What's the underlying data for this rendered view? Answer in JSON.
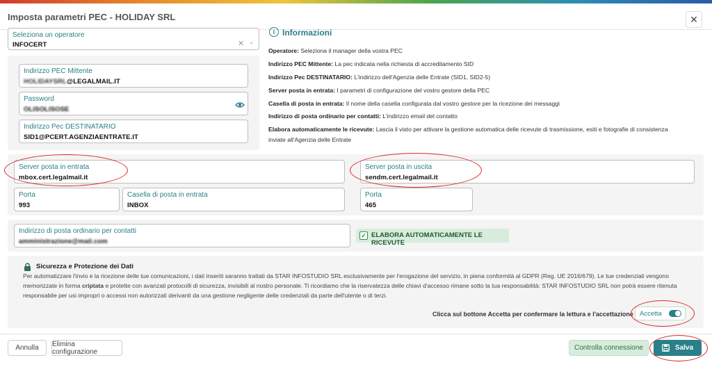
{
  "window": {
    "title": "Imposta parametri PEC - HOLIDAY SRL",
    "close_label": "✕"
  },
  "operatore": {
    "label": "Seleziona un operatore",
    "value": "INFOCERT"
  },
  "pec": {
    "mittente": {
      "label": "Indirizzo PEC Mittente",
      "value_blurred": "HOLIDAYSRL",
      "value_suffix": "@LEGALMAIL.IT"
    },
    "password": {
      "label": "Password",
      "value_blurred": "OLISOLISOSE"
    },
    "destinatario": {
      "label": "Indirizzo Pec DESTINATARIO",
      "value": "SID1@PCERT.AGENZIAENTRATE.IT"
    }
  },
  "info": {
    "title": "Informazioni",
    "lines": [
      {
        "key": "Operatore:",
        "text": " Seleziona il manager della vostra PEC"
      },
      {
        "key": "Indirizzo PEC Mittente:",
        "text": " La pec indicata nella richiesta di accreditamento SID"
      },
      {
        "key": "Indirizzo Pec DESTINATARIO:",
        "text": " L'indirizzo dell'Agenzia delle Entrate (SID1, SID2-5)"
      },
      {
        "key": "Server posta in entrata:",
        "text": " I parametri di configurazione del vostro gestore della PEC"
      },
      {
        "key": "Casella di posta in entrata:",
        "text": " Il nome della casella configurata dal vostro gestore per la ricezione dei messaggi"
      },
      {
        "key": "Indirizzo di posta ordinario per contatti:",
        "text": " L'indirizzo email del contatto"
      },
      {
        "key": "Elabora automaticamente le ricevute:",
        "text": " Lascia il visto per attivare la gestione automatica delle ricevute di trasmissione, esiti e fotografie di consistenza"
      },
      {
        "key": "",
        "text": "inviate all'Agenzia delle Entrate"
      }
    ]
  },
  "server_in": {
    "label": "Server posta in entrata",
    "value": "mbox.cert.legalmail.it"
  },
  "porta_in": {
    "label": "Porta",
    "value": "993"
  },
  "casella": {
    "label": "Casella di posta in entrata",
    "value": "INBOX"
  },
  "server_out": {
    "label": "Server posta in uscita",
    "value": "sendm.cert.legalmail.it"
  },
  "porta_out": {
    "label": "Porta",
    "value": "465"
  },
  "contatti": {
    "label": "Indirizzo di posta ordinario per contatti",
    "value_blurred": "amministrazione@mail.com"
  },
  "elabora": {
    "label": "ELABORA AUTOMATICAMENTE LE RICEVUTE",
    "checked": true
  },
  "sicurezza": {
    "title": "Sicurezza e Protezione dei Dati",
    "p1": "Per automatizzare l'invio e la ricezione delle tue comunicazioni, i dati inseriti saranno trattati da STAR INFOSTUDIO SRL esclusivamente per l'erogazione del servizio, in piena conformità al GDPR (Reg. UE 2016/679). Le tue credenziali vengono memorizzate in forma ",
    "p1_bold": "criptata",
    "p2": " e protette con avanzati protocolli di sicurezza, invisibili al nostro personale. Ti ricordiamo che la riservatezza delle chiavi d'accesso rimane sotto la tua responsabilità: STAR INFOSTUDIO SRL non potrà essere ritenuta responsabile per usi impropri o accessi non autorizzati derivanti da una gestione negligente delle credenziali da parte dell'utente o di terzi.",
    "prompt": "Clicca sul bottone Accetta per confermare la lettura e l'accettazione",
    "accept_label": "Accetta",
    "accepted": true
  },
  "footer": {
    "annulla": "Annulla",
    "elimina": "Elimina configurazione",
    "controlla": "Controlla connessione",
    "salva": "Salva"
  }
}
